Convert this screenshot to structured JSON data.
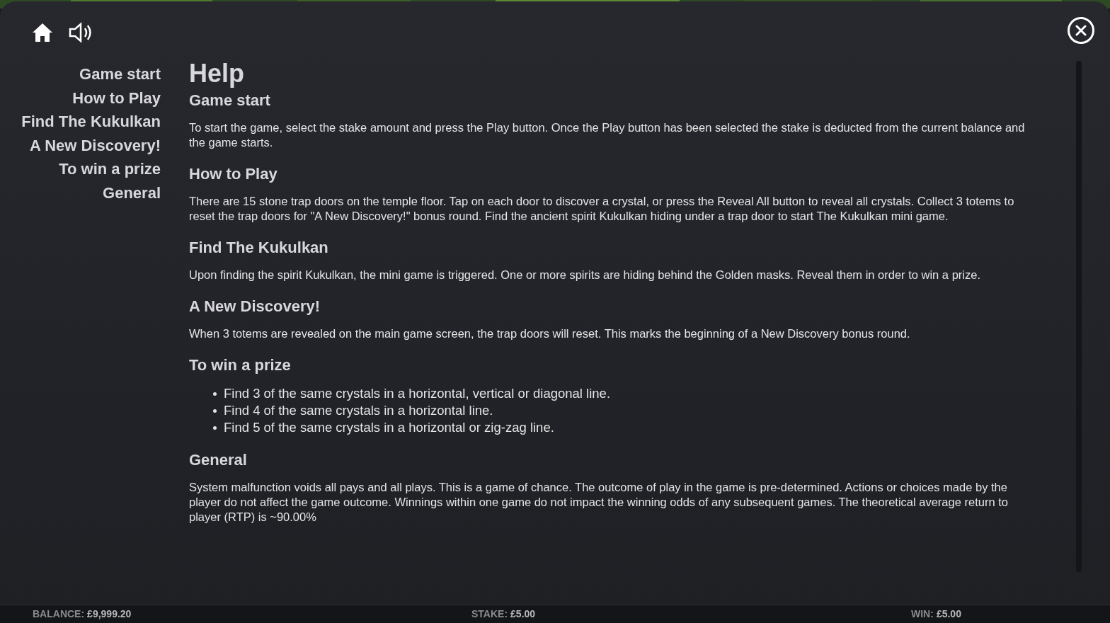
{
  "nav": [
    "Game start",
    "How to Play",
    "Find The Kukulkan",
    "A New Discovery!",
    "To win a prize",
    "General"
  ],
  "title": "Help",
  "sections": [
    {
      "heading": "Game start",
      "kind": "paragraph",
      "text": "To start the game, select the stake amount and press the Play button. Once the Play button has been selected the stake is deducted from the current balance and the game starts."
    },
    {
      "heading": "How to Play",
      "kind": "paragraph",
      "text": "There are 15 stone trap doors on the temple floor. Tap on each door to discover a crystal, or press the Reveal All button to reveal all crystals. Collect 3 totems to reset the trap doors for \"A New Discovery!\" bonus round. Find the ancient spirit Kukulkan hiding under a trap door to start The Kukulkan mini game."
    },
    {
      "heading": "Find The Kukulkan",
      "kind": "paragraph",
      "text": "Upon finding the spirit Kukulkan, the mini game is triggered. One or more spirits are hiding behind the Golden masks. Reveal them in order to win a prize."
    },
    {
      "heading": "A New Discovery!",
      "kind": "paragraph",
      "text": "When 3 totems are revealed on the main game screen, the trap doors will reset. This marks the beginning of a New Discovery bonus round."
    },
    {
      "heading": "To win a prize",
      "kind": "list",
      "items": [
        "Find 3 of the same crystals in a horizontal, vertical or diagonal line.",
        "Find 4 of the same crystals in a horizontal line.",
        "Find 5 of the same crystals in a horizontal or zig-zag line."
      ]
    },
    {
      "heading": "General",
      "kind": "paragraph",
      "text": "System malfunction voids all pays and all plays. This is a game of chance. The outcome of play in the game is pre-determined. Actions or choices made by the player do not affect the game outcome. Winnings within one game do not impact the winning odds of any subsequent games. The theoretical average return to player (RTP) is ~90.00%"
    }
  ],
  "status_bar": [
    {
      "label": "BALANCE:",
      "value": "£9,999.20"
    },
    {
      "label": "STAKE:",
      "value": "£5.00"
    },
    {
      "label": "WIN:",
      "value": "£5.00"
    }
  ]
}
